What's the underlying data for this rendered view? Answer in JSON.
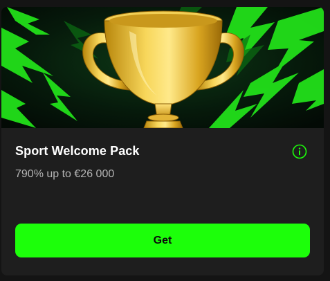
{
  "promo": {
    "title": "Sport Welcome Pack",
    "subtitle": "790% up to €26 000",
    "button_label": "Get",
    "hero_image": "trophy-lightning-banner",
    "info_icon": "info-icon"
  },
  "colors": {
    "accent": "#1cff0a",
    "card_background": "#1e1e1e",
    "page_background": "#141414",
    "title_text": "#ffffff",
    "subtitle_text": "#b5b5b5"
  }
}
